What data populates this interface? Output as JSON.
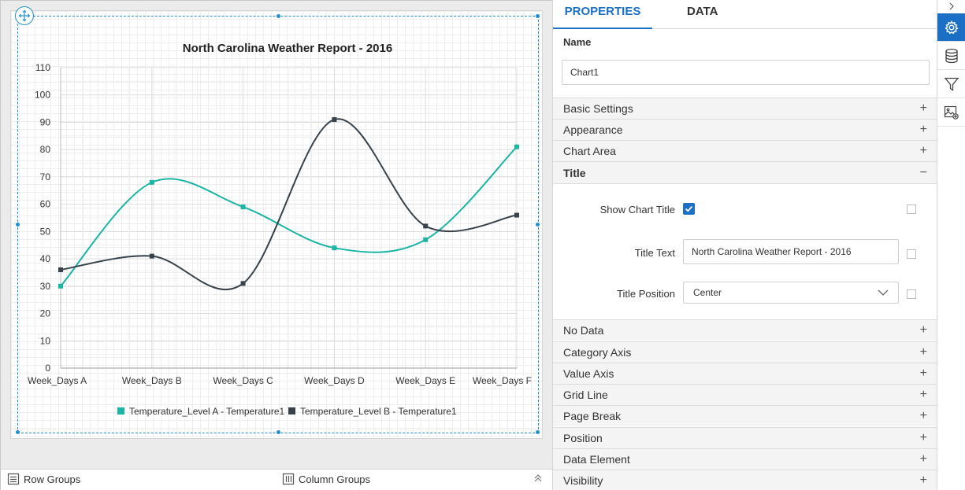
{
  "designer": {
    "row_groups_label": "Row Groups",
    "column_groups_label": "Column Groups"
  },
  "panel": {
    "tabs": [
      {
        "label": "PROPERTIES",
        "active": true
      },
      {
        "label": "DATA",
        "active": false
      }
    ],
    "name_label": "Name",
    "name_value": "Chart1",
    "sections_before": [
      {
        "label": "Basic Settings",
        "sign": "+"
      },
      {
        "label": "Appearance",
        "sign": "+"
      },
      {
        "label": "Chart Area",
        "sign": "+"
      }
    ],
    "title_section": {
      "label": "Title",
      "sign": "−",
      "show_title_label": "Show Chart Title",
      "show_title_checked": true,
      "title_text_label": "Title Text",
      "title_text_value": "North Carolina Weather Report - 2016",
      "title_position_label": "Title Position",
      "title_position_value": "Center"
    },
    "sections_after": [
      {
        "label": "No Data",
        "sign": "+"
      },
      {
        "label": "Category Axis",
        "sign": "+"
      },
      {
        "label": "Value Axis",
        "sign": "+"
      },
      {
        "label": "Grid Line",
        "sign": "+"
      },
      {
        "label": "Page Break",
        "sign": "+"
      },
      {
        "label": "Position",
        "sign": "+"
      },
      {
        "label": "Data Element",
        "sign": "+"
      },
      {
        "label": "Visibility",
        "sign": "+"
      }
    ]
  },
  "rail": {
    "icons": [
      "chevron-right-icon",
      "gear-icon",
      "database-icon",
      "filter-icon",
      "image-settings-icon"
    ]
  },
  "colors": {
    "accent": "#1b6fc4",
    "series_a": "#1ab5a4",
    "series_b": "#37424a",
    "selection": "#1f8fd0"
  },
  "chart_data": {
    "type": "line",
    "title": "North Carolina Weather Report - 2016",
    "categories": [
      "Week_Days A",
      "Week_Days B",
      "Week_Days C",
      "Week_Days D",
      "Week_Days E",
      "Week_Days F"
    ],
    "series": [
      {
        "name": "Temperature_Level A - Temperature1",
        "values": [
          30,
          68,
          59,
          44,
          47,
          81
        ]
      },
      {
        "name": "Temperature_Level B - Temperature1",
        "values": [
          36,
          41,
          31,
          91,
          52,
          56
        ]
      }
    ],
    "ylim": [
      0,
      110
    ],
    "yticks": [
      0,
      10,
      20,
      30,
      40,
      50,
      60,
      70,
      80,
      90,
      100,
      110
    ],
    "grid": true,
    "smooth": true,
    "legend": "bottom"
  }
}
